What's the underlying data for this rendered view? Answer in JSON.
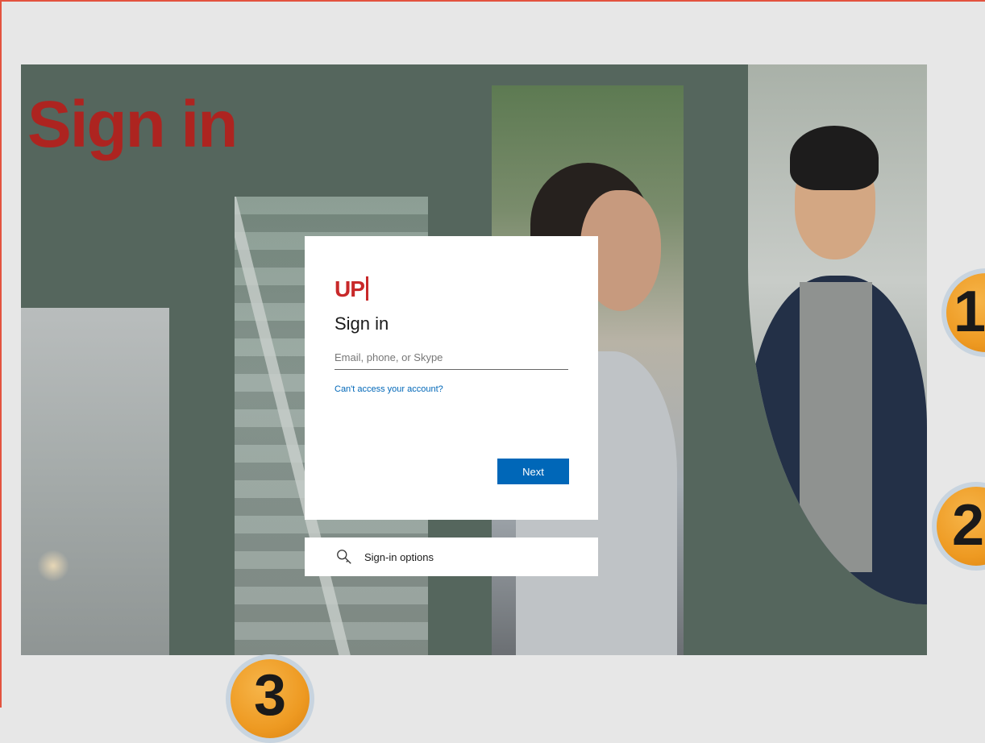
{
  "slide": {
    "title": "Sign in"
  },
  "signin_card": {
    "logo_text": "UP",
    "title": "Sign in",
    "email_placeholder": "Email, phone, or Skype",
    "email_value": "",
    "help_link": "Can't access your account?",
    "next_label": "Next"
  },
  "options_bar": {
    "icon": "key-search-icon",
    "label": "Sign-in options"
  },
  "steps": {
    "one": "1",
    "two": "2",
    "three": "3"
  },
  "colors": {
    "title_red": "#ad2420",
    "slide_bg": "#55665d",
    "accent_blue": "#0067b8",
    "step_orange": "#ee9a22"
  }
}
